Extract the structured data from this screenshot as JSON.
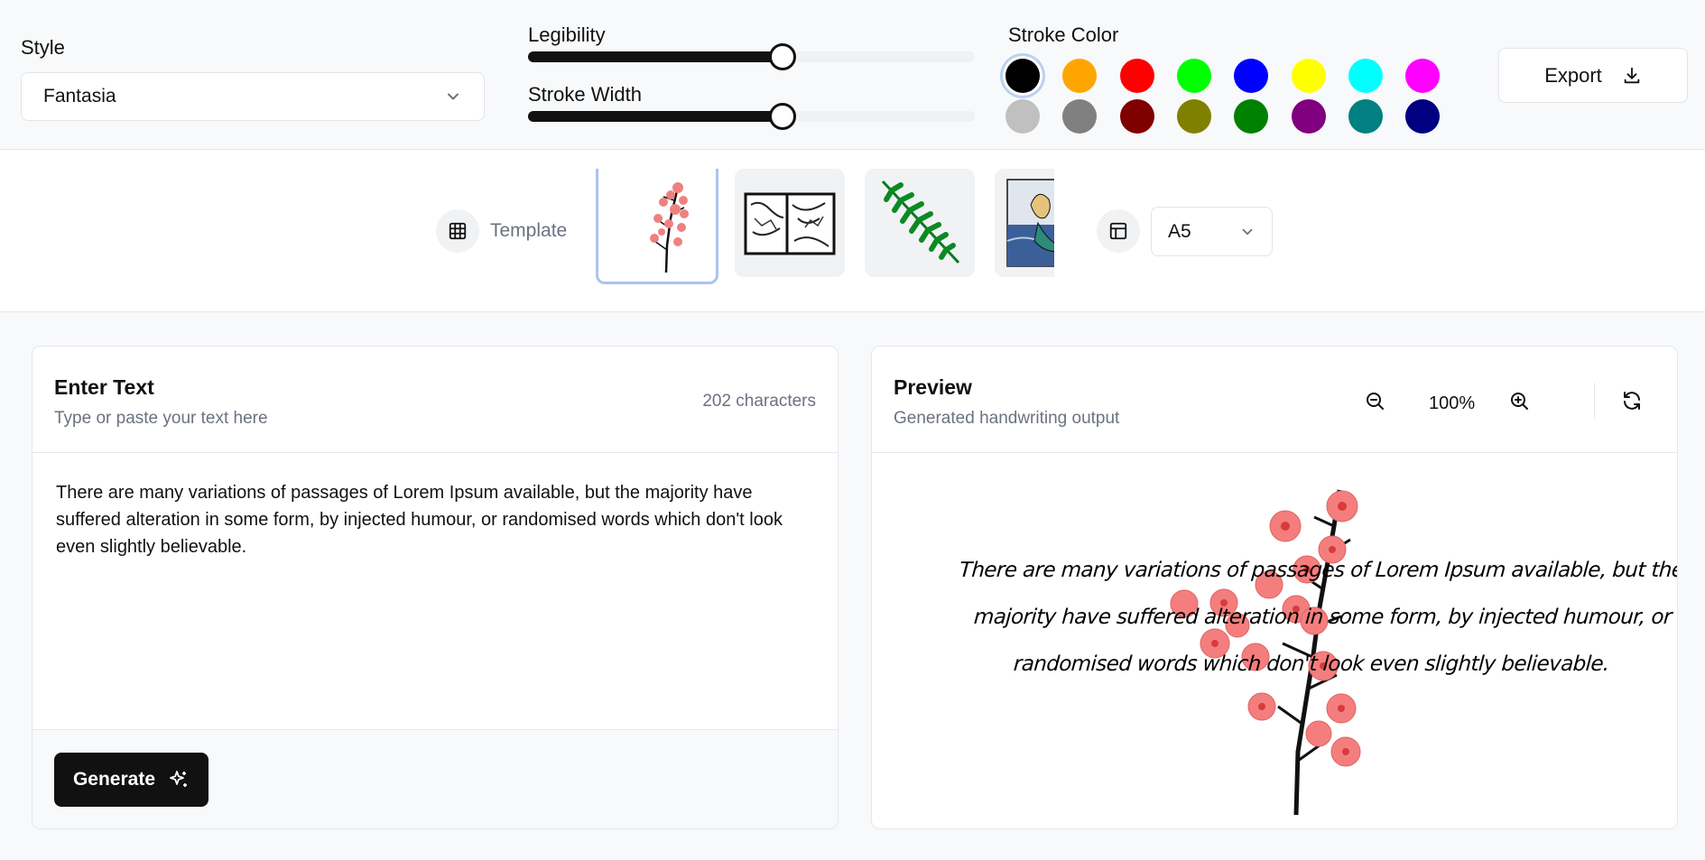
{
  "toolbar": {
    "style_label": "Style",
    "style_value": "Fantasia",
    "legibility_label": "Legibility",
    "legibility_value": 0.57,
    "stroke_width_label": "Stroke Width",
    "stroke_width_value": 0.57,
    "stroke_color_label": "Stroke Color",
    "colors": [
      "#000000",
      "#ffa500",
      "#ff0000",
      "#00ff00",
      "#0000ff",
      "#ffff00",
      "#00ffff",
      "#ff00ff",
      "#c0c0c0",
      "#808080",
      "#800000",
      "#808000",
      "#008000",
      "#800080",
      "#008080",
      "#000080"
    ],
    "selected_color": "#000000",
    "export_label": "Export"
  },
  "templates": {
    "label": "Template",
    "items": [
      {
        "name": "pink-blossom-branch",
        "selected": true
      },
      {
        "name": "sketch-comic-panels",
        "selected": false
      },
      {
        "name": "green-fern-leaf",
        "selected": false
      },
      {
        "name": "mermaid-seascape",
        "selected": false
      }
    ],
    "page_size": "A5"
  },
  "input_panel": {
    "title": "Enter Text",
    "subtitle": "Type or paste your text here",
    "char_count": "202 characters",
    "text": "There are many variations of passages of Lorem Ipsum available, but the majority have suffered alteration in some form, by injected humour, or randomised words which don't look even slightly believable.",
    "generate_label": "Generate"
  },
  "preview_panel": {
    "title": "Preview",
    "subtitle": "Generated handwriting output",
    "zoom": "100%",
    "lines": [
      "There are many variations of passages of Lorem Ipsum available, but the",
      "majority have suffered alteration in some form, by injected humour, or",
      "randomised words which don't look even slightly believable."
    ]
  }
}
